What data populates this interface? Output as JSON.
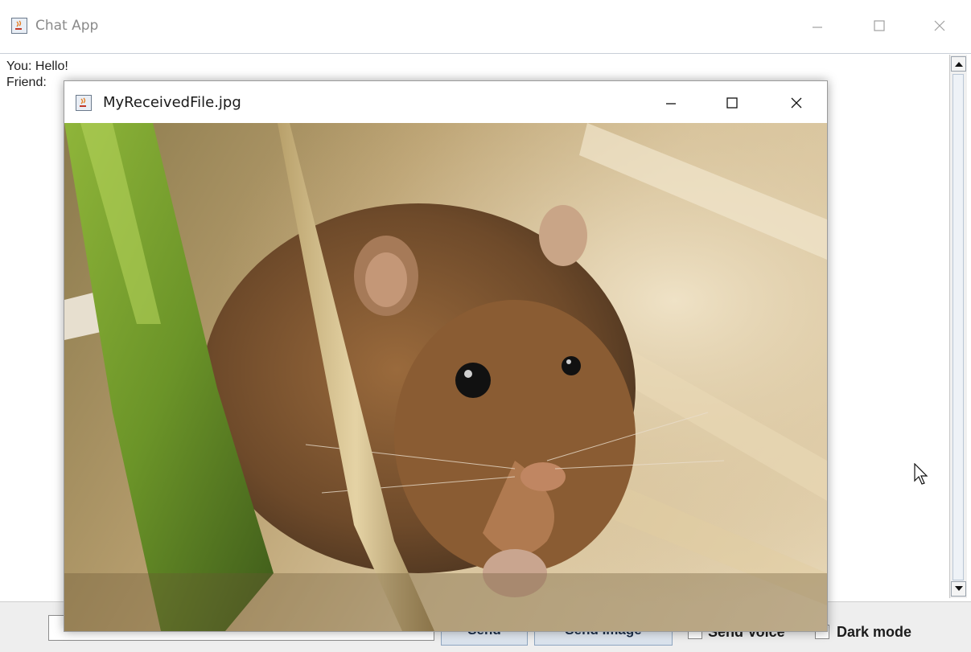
{
  "window": {
    "title": "Chat App"
  },
  "chat": {
    "messages": [
      {
        "text": "You: Hello!"
      },
      {
        "text": "Friend:"
      }
    ]
  },
  "composer": {
    "input_value": "",
    "send_label": "Send",
    "send_image_label": "Send Image",
    "send_voice_label": "Send Voice",
    "dark_mode_label": "Dark mode",
    "send_voice_checked": false,
    "dark_mode_checked": false
  },
  "viewer": {
    "title": "MyReceivedFile.jpg",
    "image_description_icon": "photo-image"
  },
  "colors": {
    "button_border": "#8fa6c0",
    "title_gray": "#8a8a8a"
  }
}
